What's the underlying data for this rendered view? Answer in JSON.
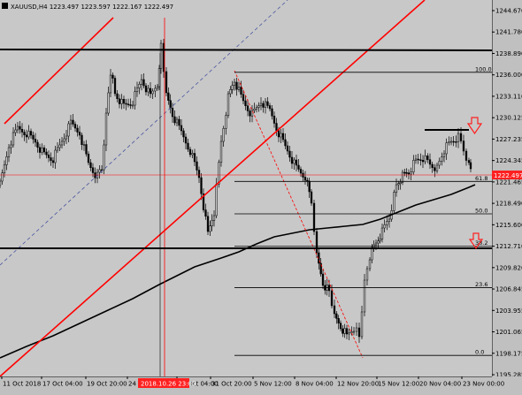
{
  "symbol_info": "XAUUSD,H4  1223.497 1223.597 1222.167 1222.497",
  "current_price": "1222.497",
  "price_labels": [
    "1244.670",
    "1241.780",
    "1238.890",
    "1236.000",
    "1233.110",
    "1230.125",
    "1227.235",
    "1224.345",
    "1221.465",
    "1218.490",
    "1215.600",
    "1212.710",
    "1209.820",
    "1206.845",
    "1203.955",
    "1201.065",
    "1198.175",
    "1195.285"
  ],
  "time_labels": [
    "11 Oct 2018",
    "17 Oct 04:00",
    "19 Oct 20:00",
    "24 Oct",
    "29 Oct 04:00",
    "31 Oct 20:00",
    "5 Nov 12:00",
    "8 Nov 04:00",
    "12 Nov 20:00",
    "15 Nov 12:00",
    "20 Nov 04:00",
    "23 Nov 00:00"
  ],
  "crosshair_label": "2018.10.26 23:00",
  "fib_levels": [
    {
      "label": "100.0",
      "price": 1236.3
    },
    {
      "label": "61.8",
      "price": 1221.5
    },
    {
      "label": "50.0",
      "price": 1217.1
    },
    {
      "label": "38.2",
      "price": 1212.7
    },
    {
      "label": "23.6",
      "price": 1207.1
    },
    {
      "label": "0.0",
      "price": 1197.9
    }
  ],
  "colors": {
    "background": "#c8c8c8",
    "bull": "#000000",
    "bear": "#000000",
    "trend": "#ff0000",
    "ma": "#000000",
    "level": "#000000",
    "arrow": "#ff2020"
  },
  "icons": [
    "down-arrow-icon",
    "down-arrow-icon"
  ]
}
